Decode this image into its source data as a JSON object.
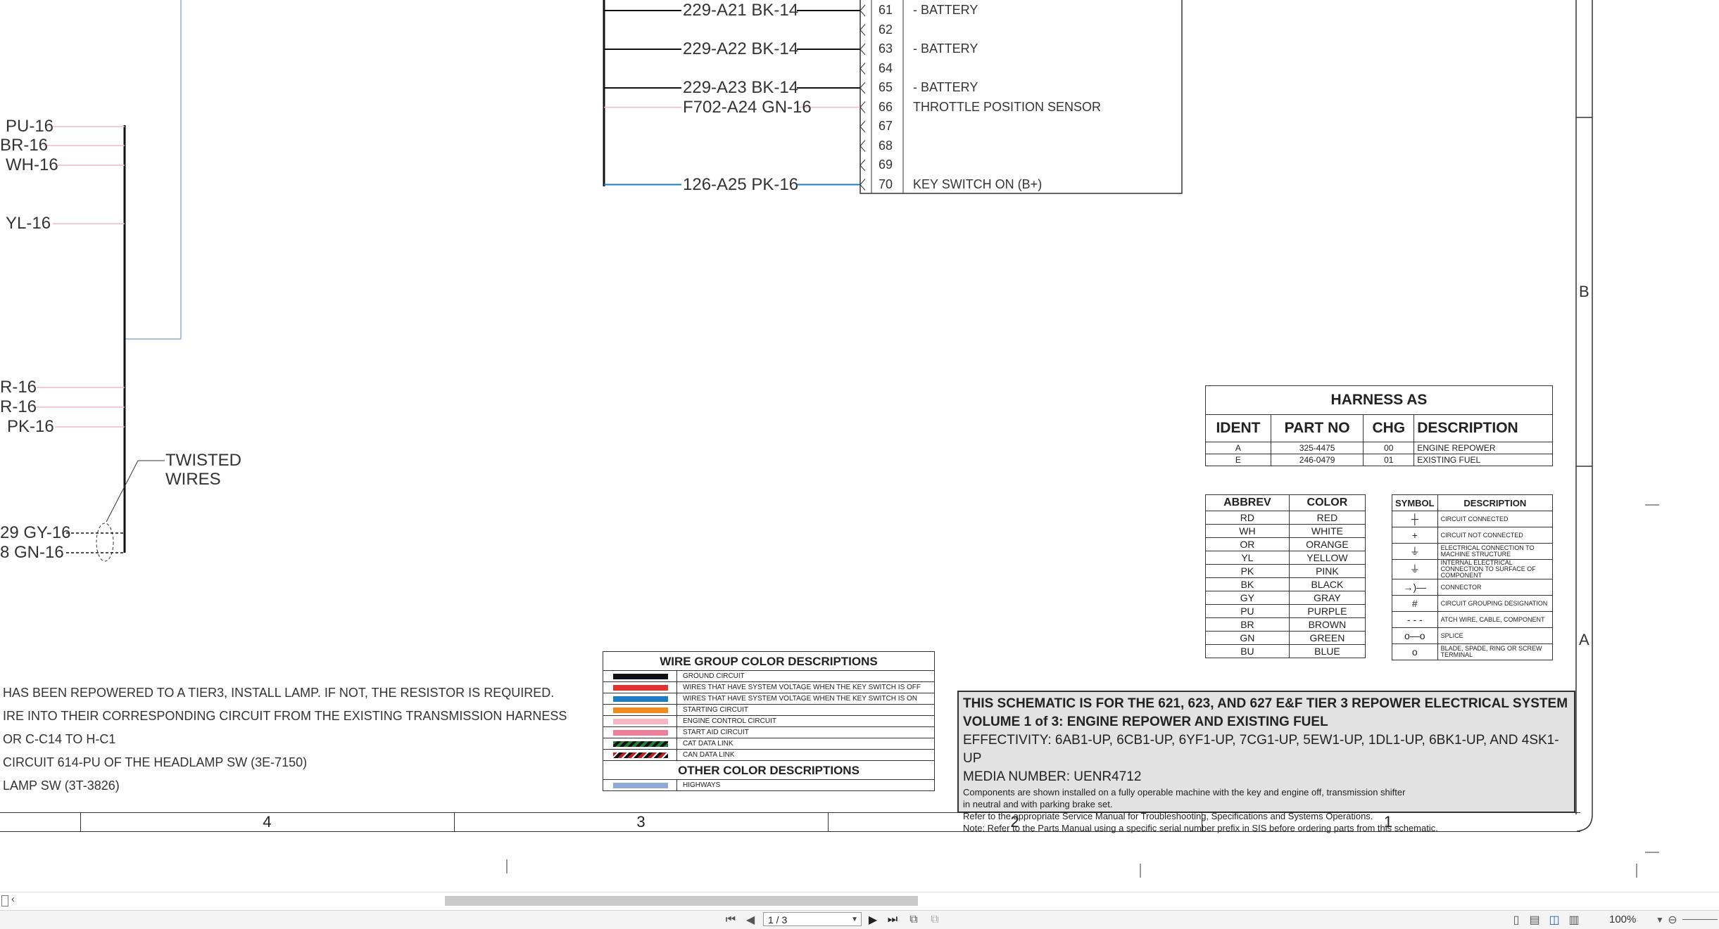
{
  "wires_top": [
    {
      "label": "229-A21 BK-14",
      "pin": "61",
      "desc": "- BATTERY"
    },
    {
      "label": "",
      "pin": "62",
      "desc": ""
    },
    {
      "label": "229-A22 BK-14",
      "pin": "63",
      "desc": "- BATTERY"
    },
    {
      "label": "",
      "pin": "64",
      "desc": ""
    },
    {
      "label": "229-A23 BK-14",
      "pin": "65",
      "desc": "- BATTERY"
    },
    {
      "label": "F702-A24 GN-16",
      "pin": "66",
      "desc": "THROTTLE POSITION SENSOR"
    },
    {
      "label": "",
      "pin": "67",
      "desc": ""
    },
    {
      "label": "",
      "pin": "68",
      "desc": ""
    },
    {
      "label": "",
      "pin": "69",
      "desc": ""
    },
    {
      "label": "126-A25 PK-16",
      "pin": "70",
      "desc": "KEY SWITCH ON (B+)"
    }
  ],
  "wires_left": [
    "PU-16",
    "BR-16",
    "WH-16",
    "YL-16",
    "R-16",
    "R-16",
    "PK-16",
    "29 GY-16",
    "8 GN-16"
  ],
  "twisted_label": [
    "TWISTED",
    "WIRES"
  ],
  "notes": [
    "HAS BEEN REPOWERED TO A TIER3, INSTALL LAMP. IF NOT, THE RESISTOR IS REQUIRED.",
    "IRE INTO THEIR CORRESPONDING CIRCUIT FROM THE EXISTING TRANSMISSION HARNESS",
    "OR C-C14 TO H-C1",
    "CIRCUIT 614-PU OF THE HEADLAMP SW (3E-7150)",
    "LAMP SW (3T-3826)"
  ],
  "wire_group": {
    "title": "WIRE GROUP COLOR DESCRIPTIONS",
    "rows": [
      {
        "color": "#111111",
        "label": "GROUND CIRCUIT"
      },
      {
        "color": "#e03030",
        "label": "WIRES THAT HAVE SYSTEM VOLTAGE WHEN THE KEY SWITCH IS OFF"
      },
      {
        "color": "#1c7ec0",
        "label": "WIRES THAT HAVE SYSTEM VOLTAGE WHEN THE KEY SWITCH IS ON"
      },
      {
        "color": "#f08a1c",
        "label": "STARTING CIRCUIT"
      },
      {
        "color": "#f4b8c4",
        "label": "ENGINE CONTROL CIRCUIT"
      },
      {
        "color": "#ee7f9c",
        "label": "START AID CIRCUIT"
      },
      {
        "color": "stripe-green",
        "label": "CAT DATA LINK"
      },
      {
        "color": "stripe-red",
        "label": "CAN DATA LINK"
      }
    ],
    "other_title": "OTHER COLOR DESCRIPTIONS",
    "other_rows": [
      {
        "color": "#8eaadb",
        "label": "HIGHWAYS"
      }
    ]
  },
  "harness": {
    "title": "HARNESS AS",
    "headers": [
      "IDENT",
      "PART NO",
      "CHG",
      "DESCRIPTION"
    ],
    "rows": [
      [
        "A",
        "325-4475",
        "00",
        "ENGINE REPOWER"
      ],
      [
        "E",
        "246-0479",
        "01",
        "EXISTING FUEL"
      ]
    ]
  },
  "abbrev": {
    "headers": [
      "ABBREV",
      "COLOR"
    ],
    "rows": [
      [
        "RD",
        "RED"
      ],
      [
        "WH",
        "WHITE"
      ],
      [
        "OR",
        "ORANGE"
      ],
      [
        "YL",
        "YELLOW"
      ],
      [
        "PK",
        "PINK"
      ],
      [
        "BK",
        "BLACK"
      ],
      [
        "GY",
        "GRAY"
      ],
      [
        "PU",
        "PURPLE"
      ],
      [
        "BR",
        "BROWN"
      ],
      [
        "GN",
        "GREEN"
      ],
      [
        "BU",
        "BLUE"
      ]
    ]
  },
  "symbols": {
    "headers": [
      "SYMBOL",
      "DESCRIPTION"
    ],
    "rows": [
      [
        "CIRCUIT CONNECTED"
      ],
      [
        "CIRCUIT NOT CONNECTED"
      ],
      [
        "ELECTRICAL CONNECTION TO MACHINE STRUCTURE"
      ],
      [
        "INTERNAL ELECTRICAL CONNECTION TO SURFACE OF COMPONENT"
      ],
      [
        "CONNECTOR"
      ],
      [
        "CIRCUIT GROUPING DESIGNATION"
      ],
      [
        "ATCH WIRE, CABLE, COMPONENT"
      ],
      [
        "SPLICE"
      ],
      [
        "BLADE, SPADE, RING OR SCREW TERMINAL"
      ]
    ]
  },
  "info": {
    "line1": "THIS SCHEMATIC IS FOR THE 621, 623, AND 627 E&F TIER 3 REPOWER ELECTRICAL SYSTEM",
    "line2": "VOLUME 1 of 3: ENGINE REPOWER AND EXISTING FUEL",
    "line3": "EFFECTIVITY: 6AB1-UP, 6CB1-UP, 6YF1-UP, 7CG1-UP, 5EW1-UP, 1DL1-UP, 6BK1-UP, AND 4SK1-UP",
    "line4": "MEDIA NUMBER: UENR4712",
    "line5": "Components are shown installed on a fully operable machine with the key and engine off, transmission shifter",
    "line6": "in neutral and with parking brake set.",
    "line7": "Refer to the appropriate Service Manual for Troubleshooting, Specifications and Systems Operations.",
    "line8": "Note: Refer to the Parts Manual using a specific serial number prefix in SIS before ordering parts from this schematic."
  },
  "zones": [
    "4",
    "3",
    "2",
    "1"
  ],
  "row_letters": [
    "B",
    "A"
  ],
  "viewer": {
    "page": "1 / 3",
    "zoom": "100%"
  }
}
